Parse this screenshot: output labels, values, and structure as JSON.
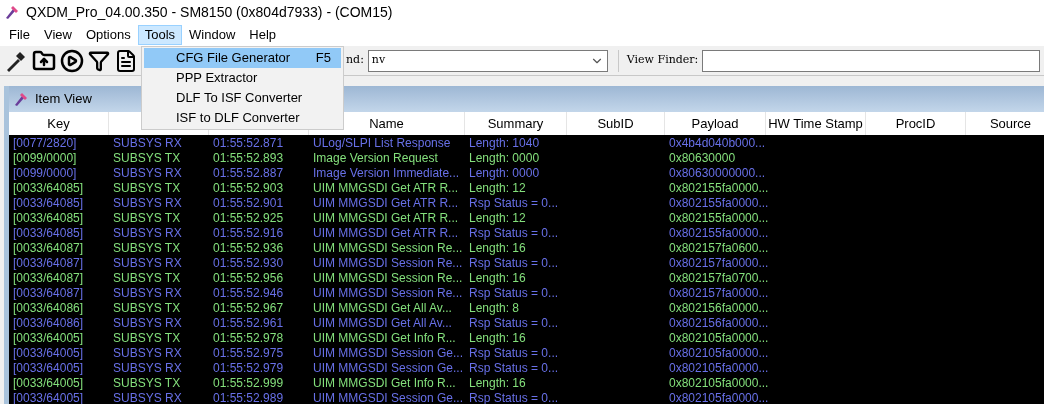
{
  "window": {
    "title": "QXDM_Pro_04.00.350 - SM8150 (0x804d7933) - (COM15)"
  },
  "menu": [
    {
      "label": "File",
      "selected": false
    },
    {
      "label": "View",
      "selected": false
    },
    {
      "label": "Options",
      "selected": false
    },
    {
      "label": "Tools",
      "selected": true
    },
    {
      "label": "Window",
      "selected": false
    },
    {
      "label": "Help",
      "selected": false
    }
  ],
  "dropdown": [
    {
      "label": "CFG File Generator",
      "shortcut": "F5",
      "selected": true
    },
    {
      "label": "PPP Extractor",
      "selected": false
    },
    {
      "label": "DLF To ISF Converter",
      "selected": false
    },
    {
      "label": "ISF to DLF Converter",
      "selected": false
    }
  ],
  "toolbar": {
    "find_label": "nd:",
    "find_value": "nv",
    "view_finder_label": "View Finder:"
  },
  "item_view": {
    "title": "Item View",
    "columns": [
      "Key",
      null,
      null,
      "Name",
      "Summary",
      "SubID",
      "Payload",
      "HW Time Stamp",
      "ProcID",
      "Source"
    ],
    "rows": [
      {
        "color": "#6870e8",
        "cells": [
          "[0077/2820]",
          "SUBSYS RX",
          "01:55:52.871",
          "ULog/SLPI List Response",
          "Length: 1040",
          "0x4b4d040b000..."
        ]
      },
      {
        "color": "#84e07c",
        "cells": [
          "[0099/0000]",
          "SUBSYS TX",
          "01:55:52.893",
          "Image Version Request",
          "Length: 0000",
          "0x80630000"
        ]
      },
      {
        "color": "#6870e8",
        "cells": [
          "[0099/0000]",
          "SUBSYS RX",
          "01:55:52.887",
          "Image Version Immediate...",
          "Length: 0000",
          "0x80630000000..."
        ]
      },
      {
        "color": "#84e07c",
        "cells": [
          "[0033/64085]",
          "SUBSYS TX",
          "01:55:52.903",
          "UIM MMGSDI Get ATR R...",
          "Length: 12",
          "0x802155fa0000..."
        ]
      },
      {
        "color": "#6870e8",
        "cells": [
          "[0033/64085]",
          "SUBSYS RX",
          "01:55:52.901",
          "UIM MMGSDI Get ATR R...",
          "Rsp Status = 0...",
          "0x802155fa0000..."
        ]
      },
      {
        "color": "#84e07c",
        "cells": [
          "[0033/64085]",
          "SUBSYS TX",
          "01:55:52.925",
          "UIM MMGSDI Get ATR R...",
          "Length: 12",
          "0x802155fa0000..."
        ]
      },
      {
        "color": "#6870e8",
        "cells": [
          "[0033/64085]",
          "SUBSYS RX",
          "01:55:52.916",
          "UIM MMGSDI Get ATR R...",
          "Rsp Status = 0...",
          "0x802155fa0000..."
        ]
      },
      {
        "color": "#84e07c",
        "cells": [
          "[0033/64087]",
          "SUBSYS TX",
          "01:55:52.936",
          "UIM MMGSDI Session Re...",
          "Length: 16",
          "0x802157fa0600..."
        ]
      },
      {
        "color": "#6870e8",
        "cells": [
          "[0033/64087]",
          "SUBSYS RX",
          "01:55:52.930",
          "UIM MMGSDI Session Re...",
          "Rsp Status = 0...",
          "0x802157fa0000..."
        ]
      },
      {
        "color": "#84e07c",
        "cells": [
          "[0033/64087]",
          "SUBSYS TX",
          "01:55:52.956",
          "UIM MMGSDI Session Re...",
          "Length: 16",
          "0x802157fa0700..."
        ]
      },
      {
        "color": "#6870e8",
        "cells": [
          "[0033/64087]",
          "SUBSYS RX",
          "01:55:52.946",
          "UIM MMGSDI Session Re...",
          "Rsp Status = 0...",
          "0x802157fa0000..."
        ]
      },
      {
        "color": "#84e07c",
        "cells": [
          "[0033/64086]",
          "SUBSYS TX",
          "01:55:52.967",
          "UIM MMGSDI Get All Av...",
          "Length: 8",
          "0x802156fa0000..."
        ]
      },
      {
        "color": "#6870e8",
        "cells": [
          "[0033/64086]",
          "SUBSYS RX",
          "01:55:52.961",
          "UIM MMGSDI Get All Av...",
          "Rsp Status = 0...",
          "0x802156fa0000..."
        ]
      },
      {
        "color": "#84e07c",
        "cells": [
          "[0033/64005]",
          "SUBSYS TX",
          "01:55:52.978",
          "UIM MMGSDI Get Info R...",
          "Length: 16",
          "0x802105fa0000..."
        ]
      },
      {
        "color": "#6870e8",
        "cells": [
          "[0033/64005]",
          "SUBSYS RX",
          "01:55:52.975",
          "UIM MMGSDI Session Ge...",
          "Rsp Status = 0...",
          "0x802105fa0000..."
        ]
      },
      {
        "color": "#6870e8",
        "cells": [
          "[0033/64005]",
          "SUBSYS RX",
          "01:55:52.979",
          "UIM MMGSDI Session Ge...",
          "Rsp Status = 0...",
          "0x802105fa0000..."
        ]
      },
      {
        "color": "#84e07c",
        "cells": [
          "[0033/64005]",
          "SUBSYS TX",
          "01:55:52.999",
          "UIM MMGSDI Get Info R...",
          "Length: 16",
          "0x802105fa0000..."
        ]
      },
      {
        "color": "#6870e8",
        "cells": [
          "[0033/64005]",
          "SUBSYS RX",
          "01:55:52.989",
          "UIM MMGSDI Session Ge...",
          "Rsp Status = 0...",
          "0x802105fa0000..."
        ]
      }
    ]
  }
}
